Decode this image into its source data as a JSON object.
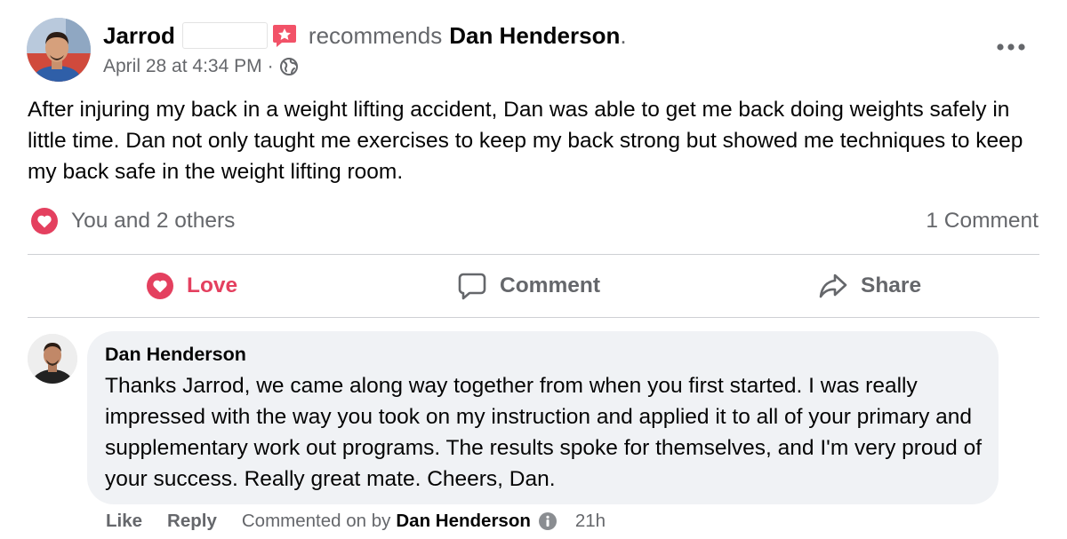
{
  "post": {
    "author_name": "Jarrod",
    "verb": "recommends",
    "target_page": "Dan Henderson",
    "period": ".",
    "timestamp": "April 28 at 4:34 PM",
    "separator": "·",
    "body": "After injuring my back in a weight lifting accident, Dan was able to get me back doing weights safely in little time. Dan not only taught me exercises to keep my back strong but showed me techniques to keep my back safe in the weight lifting room.",
    "reactions_summary": "You and 2 others",
    "comment_count": "1 Comment"
  },
  "actions": {
    "love": "Love",
    "comment": "Comment",
    "share": "Share"
  },
  "comment": {
    "author": "Dan Henderson",
    "text": "Thanks Jarrod, we came along way together from when you first started. I was really impressed with the way you took on my instruction and applied it to all of your primary and supplementary work out programs. The results spoke for themselves, and I'm very proud of your success. Really great mate. Cheers, Dan.",
    "like": "Like",
    "reply": "Reply",
    "commented_on_by": "Commented on by",
    "commented_by_name": "Dan Henderson",
    "time": "21h"
  },
  "colors": {
    "love_red": "#e4405f",
    "secondary_text": "#65676b",
    "bubble_bg": "#f0f2f5",
    "divider": "#ced0d4"
  },
  "icons": [
    "recommendation-star-icon",
    "globe-icon",
    "more-options-icon",
    "love-heart-icon",
    "comment-bubble-icon",
    "share-arrow-icon",
    "info-icon"
  ]
}
